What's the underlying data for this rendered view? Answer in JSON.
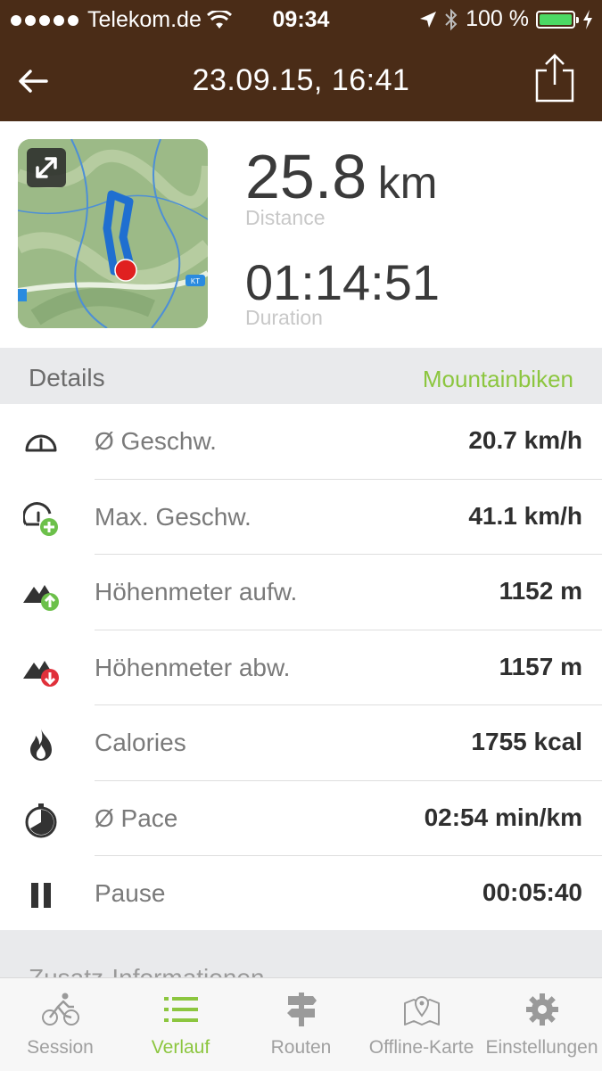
{
  "status_bar": {
    "carrier": "Telekom.de",
    "time": "09:34",
    "battery": "100 %",
    "battery_color": "#4cd964"
  },
  "nav": {
    "title": "23.09.15, 16:41",
    "back_icon": "back-arrow-icon",
    "share_icon": "share-icon"
  },
  "summary": {
    "distance_value": "25.8",
    "distance_unit": "km",
    "distance_label": "Distance",
    "duration_value": "01:14:51",
    "duration_label": "Duration",
    "map_badge_1": "KT"
  },
  "details": {
    "title": "Details",
    "activity": "Mountainbiken",
    "activity_color": "#8cc63f",
    "rows": [
      {
        "icon": "speedometer-icon",
        "label": "Ø Geschw.",
        "value": "20.7 km/h"
      },
      {
        "icon": "max-speed-icon",
        "label": "Max. Geschw.",
        "value": "41.1 km/h"
      },
      {
        "icon": "elevation-up-icon",
        "label": "Höhenmeter aufw.",
        "value": "1152 m"
      },
      {
        "icon": "elevation-down-icon",
        "label": "Höhenmeter abw.",
        "value": "1157 m"
      },
      {
        "icon": "flame-icon",
        "label": "Calories",
        "value": "1755 kcal"
      },
      {
        "icon": "stopwatch-icon",
        "label": "Ø Pace",
        "value": "02:54 min/km"
      },
      {
        "icon": "pause-icon",
        "label": "Pause",
        "value": "00:05:40"
      }
    ]
  },
  "extra_section": {
    "title": "Zusatz-Informationen"
  },
  "tabs": [
    {
      "icon": "cyclist-icon",
      "label": "Session",
      "active": false
    },
    {
      "icon": "list-icon",
      "label": "Verlauf",
      "active": true
    },
    {
      "icon": "signpost-icon",
      "label": "Routen",
      "active": false
    },
    {
      "icon": "map-pin-icon",
      "label": "Offline-Karte",
      "active": false
    },
    {
      "icon": "gear-icon",
      "label": "Einstellungen",
      "active": false
    }
  ]
}
